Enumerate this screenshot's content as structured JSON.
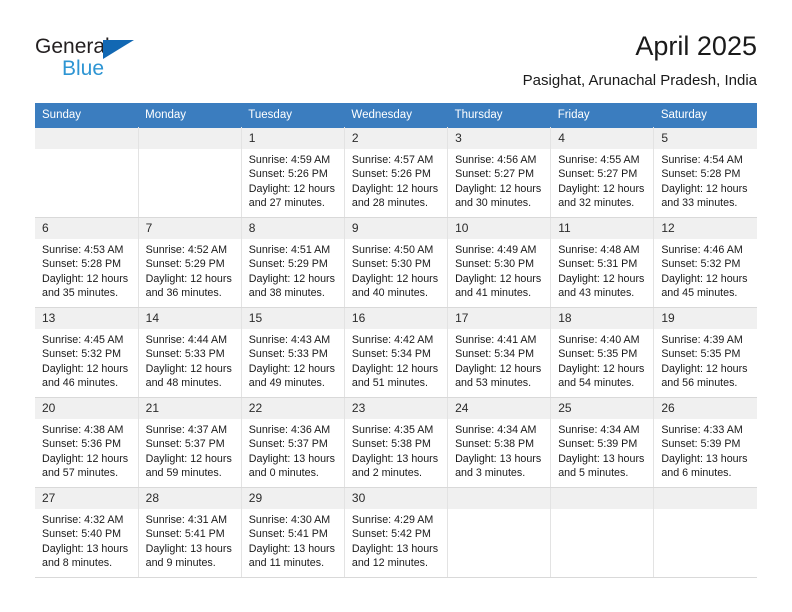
{
  "brand": {
    "name_part1": "General",
    "name_part2": "Blue",
    "triangle_icon": "blue-triangle-icon",
    "accent_color": "#2e95d3",
    "dark_color": "#231f20"
  },
  "header": {
    "title": "April 2025",
    "subtitle": "Pasighat, Arunachal Pradesh, India"
  },
  "theme": {
    "header_row_bg": "#3b7dbf",
    "daynum_bg": "#f0f0f0",
    "cell_border": "#e3e3e3"
  },
  "weekdays": [
    "Sunday",
    "Monday",
    "Tuesday",
    "Wednesday",
    "Thursday",
    "Friday",
    "Saturday"
  ],
  "labels": {
    "sunrise": "Sunrise:",
    "sunset": "Sunset:",
    "daylight": "Daylight:"
  },
  "weeks": [
    [
      {
        "day": "",
        "sunrise": "",
        "sunset": "",
        "daylight_line1": "",
        "daylight_line2": ""
      },
      {
        "day": "",
        "sunrise": "",
        "sunset": "",
        "daylight_line1": "",
        "daylight_line2": ""
      },
      {
        "day": "1",
        "sunrise": "Sunrise: 4:59 AM",
        "sunset": "Sunset: 5:26 PM",
        "daylight_line1": "Daylight: 12 hours",
        "daylight_line2": "and 27 minutes."
      },
      {
        "day": "2",
        "sunrise": "Sunrise: 4:57 AM",
        "sunset": "Sunset: 5:26 PM",
        "daylight_line1": "Daylight: 12 hours",
        "daylight_line2": "and 28 minutes."
      },
      {
        "day": "3",
        "sunrise": "Sunrise: 4:56 AM",
        "sunset": "Sunset: 5:27 PM",
        "daylight_line1": "Daylight: 12 hours",
        "daylight_line2": "and 30 minutes."
      },
      {
        "day": "4",
        "sunrise": "Sunrise: 4:55 AM",
        "sunset": "Sunset: 5:27 PM",
        "daylight_line1": "Daylight: 12 hours",
        "daylight_line2": "and 32 minutes."
      },
      {
        "day": "5",
        "sunrise": "Sunrise: 4:54 AM",
        "sunset": "Sunset: 5:28 PM",
        "daylight_line1": "Daylight: 12 hours",
        "daylight_line2": "and 33 minutes."
      }
    ],
    [
      {
        "day": "6",
        "sunrise": "Sunrise: 4:53 AM",
        "sunset": "Sunset: 5:28 PM",
        "daylight_line1": "Daylight: 12 hours",
        "daylight_line2": "and 35 minutes."
      },
      {
        "day": "7",
        "sunrise": "Sunrise: 4:52 AM",
        "sunset": "Sunset: 5:29 PM",
        "daylight_line1": "Daylight: 12 hours",
        "daylight_line2": "and 36 minutes."
      },
      {
        "day": "8",
        "sunrise": "Sunrise: 4:51 AM",
        "sunset": "Sunset: 5:29 PM",
        "daylight_line1": "Daylight: 12 hours",
        "daylight_line2": "and 38 minutes."
      },
      {
        "day": "9",
        "sunrise": "Sunrise: 4:50 AM",
        "sunset": "Sunset: 5:30 PM",
        "daylight_line1": "Daylight: 12 hours",
        "daylight_line2": "and 40 minutes."
      },
      {
        "day": "10",
        "sunrise": "Sunrise: 4:49 AM",
        "sunset": "Sunset: 5:30 PM",
        "daylight_line1": "Daylight: 12 hours",
        "daylight_line2": "and 41 minutes."
      },
      {
        "day": "11",
        "sunrise": "Sunrise: 4:48 AM",
        "sunset": "Sunset: 5:31 PM",
        "daylight_line1": "Daylight: 12 hours",
        "daylight_line2": "and 43 minutes."
      },
      {
        "day": "12",
        "sunrise": "Sunrise: 4:46 AM",
        "sunset": "Sunset: 5:32 PM",
        "daylight_line1": "Daylight: 12 hours",
        "daylight_line2": "and 45 minutes."
      }
    ],
    [
      {
        "day": "13",
        "sunrise": "Sunrise: 4:45 AM",
        "sunset": "Sunset: 5:32 PM",
        "daylight_line1": "Daylight: 12 hours",
        "daylight_line2": "and 46 minutes."
      },
      {
        "day": "14",
        "sunrise": "Sunrise: 4:44 AM",
        "sunset": "Sunset: 5:33 PM",
        "daylight_line1": "Daylight: 12 hours",
        "daylight_line2": "and 48 minutes."
      },
      {
        "day": "15",
        "sunrise": "Sunrise: 4:43 AM",
        "sunset": "Sunset: 5:33 PM",
        "daylight_line1": "Daylight: 12 hours",
        "daylight_line2": "and 49 minutes."
      },
      {
        "day": "16",
        "sunrise": "Sunrise: 4:42 AM",
        "sunset": "Sunset: 5:34 PM",
        "daylight_line1": "Daylight: 12 hours",
        "daylight_line2": "and 51 minutes."
      },
      {
        "day": "17",
        "sunrise": "Sunrise: 4:41 AM",
        "sunset": "Sunset: 5:34 PM",
        "daylight_line1": "Daylight: 12 hours",
        "daylight_line2": "and 53 minutes."
      },
      {
        "day": "18",
        "sunrise": "Sunrise: 4:40 AM",
        "sunset": "Sunset: 5:35 PM",
        "daylight_line1": "Daylight: 12 hours",
        "daylight_line2": "and 54 minutes."
      },
      {
        "day": "19",
        "sunrise": "Sunrise: 4:39 AM",
        "sunset": "Sunset: 5:35 PM",
        "daylight_line1": "Daylight: 12 hours",
        "daylight_line2": "and 56 minutes."
      }
    ],
    [
      {
        "day": "20",
        "sunrise": "Sunrise: 4:38 AM",
        "sunset": "Sunset: 5:36 PM",
        "daylight_line1": "Daylight: 12 hours",
        "daylight_line2": "and 57 minutes."
      },
      {
        "day": "21",
        "sunrise": "Sunrise: 4:37 AM",
        "sunset": "Sunset: 5:37 PM",
        "daylight_line1": "Daylight: 12 hours",
        "daylight_line2": "and 59 minutes."
      },
      {
        "day": "22",
        "sunrise": "Sunrise: 4:36 AM",
        "sunset": "Sunset: 5:37 PM",
        "daylight_line1": "Daylight: 13 hours",
        "daylight_line2": "and 0 minutes."
      },
      {
        "day": "23",
        "sunrise": "Sunrise: 4:35 AM",
        "sunset": "Sunset: 5:38 PM",
        "daylight_line1": "Daylight: 13 hours",
        "daylight_line2": "and 2 minutes."
      },
      {
        "day": "24",
        "sunrise": "Sunrise: 4:34 AM",
        "sunset": "Sunset: 5:38 PM",
        "daylight_line1": "Daylight: 13 hours",
        "daylight_line2": "and 3 minutes."
      },
      {
        "day": "25",
        "sunrise": "Sunrise: 4:34 AM",
        "sunset": "Sunset: 5:39 PM",
        "daylight_line1": "Daylight: 13 hours",
        "daylight_line2": "and 5 minutes."
      },
      {
        "day": "26",
        "sunrise": "Sunrise: 4:33 AM",
        "sunset": "Sunset: 5:39 PM",
        "daylight_line1": "Daylight: 13 hours",
        "daylight_line2": "and 6 minutes."
      }
    ],
    [
      {
        "day": "27",
        "sunrise": "Sunrise: 4:32 AM",
        "sunset": "Sunset: 5:40 PM",
        "daylight_line1": "Daylight: 13 hours",
        "daylight_line2": "and 8 minutes."
      },
      {
        "day": "28",
        "sunrise": "Sunrise: 4:31 AM",
        "sunset": "Sunset: 5:41 PM",
        "daylight_line1": "Daylight: 13 hours",
        "daylight_line2": "and 9 minutes."
      },
      {
        "day": "29",
        "sunrise": "Sunrise: 4:30 AM",
        "sunset": "Sunset: 5:41 PM",
        "daylight_line1": "Daylight: 13 hours",
        "daylight_line2": "and 11 minutes."
      },
      {
        "day": "30",
        "sunrise": "Sunrise: 4:29 AM",
        "sunset": "Sunset: 5:42 PM",
        "daylight_line1": "Daylight: 13 hours",
        "daylight_line2": "and 12 minutes."
      },
      {
        "day": "",
        "sunrise": "",
        "sunset": "",
        "daylight_line1": "",
        "daylight_line2": ""
      },
      {
        "day": "",
        "sunrise": "",
        "sunset": "",
        "daylight_line1": "",
        "daylight_line2": ""
      },
      {
        "day": "",
        "sunrise": "",
        "sunset": "",
        "daylight_line1": "",
        "daylight_line2": ""
      }
    ]
  ]
}
